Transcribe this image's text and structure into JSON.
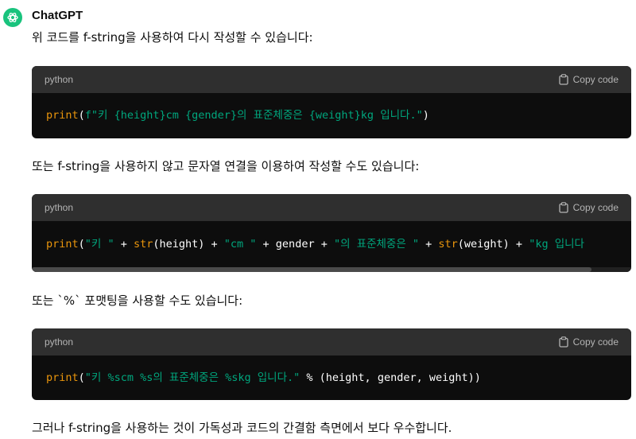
{
  "author": "ChatGPT",
  "paragraphs": {
    "p1": "위 코드를 f-string을 사용하여 다시 작성할 수 있습니다:",
    "p2": "또는 f-string을 사용하지 않고 문자열 연결을 이용하여 작성할 수도 있습니다:",
    "p3": "또는 `%` 포맷팅을 사용할 수도 있습니다:",
    "p4": "그러나 f-string을 사용하는 것이 가독성과 코드의 간결함 측면에서 보다 우수합니다."
  },
  "code_blocks": [
    {
      "language": "python",
      "copy_label": "Copy code",
      "tokens": {
        "t1": "print",
        "t2": "(",
        "t3": "f\"키 {height}cm {gender}의 표준체중은 {weight}kg 입니다.\"",
        "t4": ")"
      }
    },
    {
      "language": "python",
      "copy_label": "Copy code",
      "tokens": {
        "t1": "print",
        "t2": "(",
        "t3": "\"키 \"",
        "t4": " + ",
        "t5": "str",
        "t6": "(height) + ",
        "t7": "\"cm \"",
        "t8": " + gender + ",
        "t9": "\"의 표준체중은 \"",
        "t10": " + ",
        "t11": "str",
        "t12": "(weight) + ",
        "t13": "\"kg 입니다"
      }
    },
    {
      "language": "python",
      "copy_label": "Copy code",
      "tokens": {
        "t1": "print",
        "t2": "(",
        "t3": "\"키 %scm %s의 표준체중은 %skg 입니다.\"",
        "t4": " % (height, gender, weight))"
      }
    }
  ],
  "colors": {
    "avatar": "#19c37d",
    "code_bg": "#0d0d0d",
    "header_bg": "#2f2f2f",
    "builtin": "#e9950c",
    "string": "#00a67d"
  },
  "icons": {
    "avatar": "openai-logo-icon",
    "copy": "clipboard-icon"
  }
}
